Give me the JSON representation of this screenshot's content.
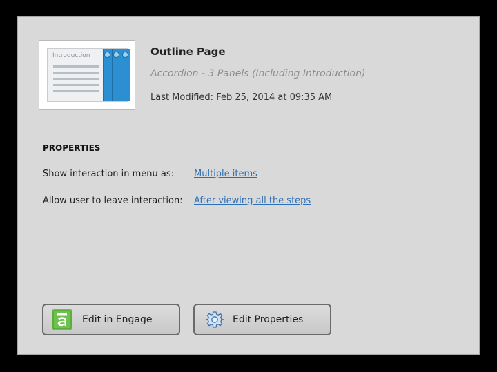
{
  "header": {
    "thumbnail_label": "Introduction",
    "title": "Outline Page",
    "subtitle": "Accordion - 3 Panels (Including Introduction)",
    "last_modified": "Last Modified: Feb 25, 2014 at 09:35 AM"
  },
  "properties": {
    "heading": "PROPERTIES",
    "rows": [
      {
        "label": "Show interaction in menu as:",
        "value": "Multiple items"
      },
      {
        "label": "Allow user to leave interaction:",
        "value": "After viewing all the steps"
      }
    ]
  },
  "buttons": {
    "edit_engage": {
      "label": "Edit in Engage",
      "icon": "engage-icon"
    },
    "edit_properties": {
      "label": "Edit Properties",
      "icon": "gear-icon"
    }
  },
  "colors": {
    "link": "#2f6fb5",
    "engage_green": "#6cc24a",
    "accordion_blue": "#2c8fd1"
  }
}
